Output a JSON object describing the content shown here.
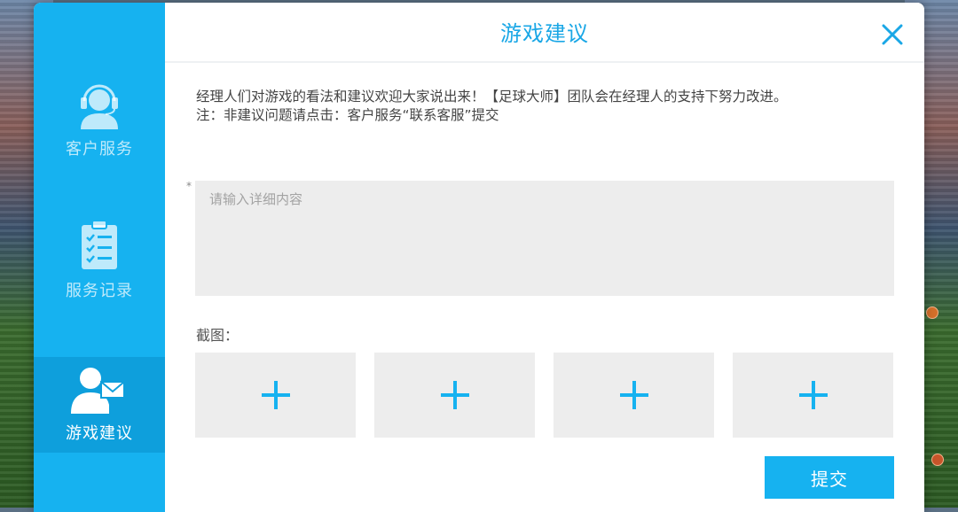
{
  "sidebar": {
    "items": [
      {
        "label": "客户服务",
        "icon": "headset-icon",
        "active": false
      },
      {
        "label": "服务记录",
        "icon": "clipboard-checklist-icon",
        "active": false
      },
      {
        "label": "游戏建议",
        "icon": "user-mail-icon",
        "active": true
      }
    ]
  },
  "dialog": {
    "title": "游戏建议",
    "close_icon": "close-icon",
    "intro_line1": "经理人们对游戏的看法和建议欢迎大家说出来！【足球大师】团队会在经理人的支持下努力改进。",
    "intro_line2": "注：非建议问题请点击：客户服务“联系客服”提交",
    "required_mark": "*",
    "textarea": {
      "value": "",
      "placeholder": "请输入详细内容"
    },
    "screenshot_label": "截图：",
    "upload_slots": 4,
    "submit_label": "提交"
  },
  "colors": {
    "accent": "#16b2f0",
    "accent_active": "#0e9fdc",
    "title": "#1aa7e6",
    "slot_bg": "#ededed"
  }
}
